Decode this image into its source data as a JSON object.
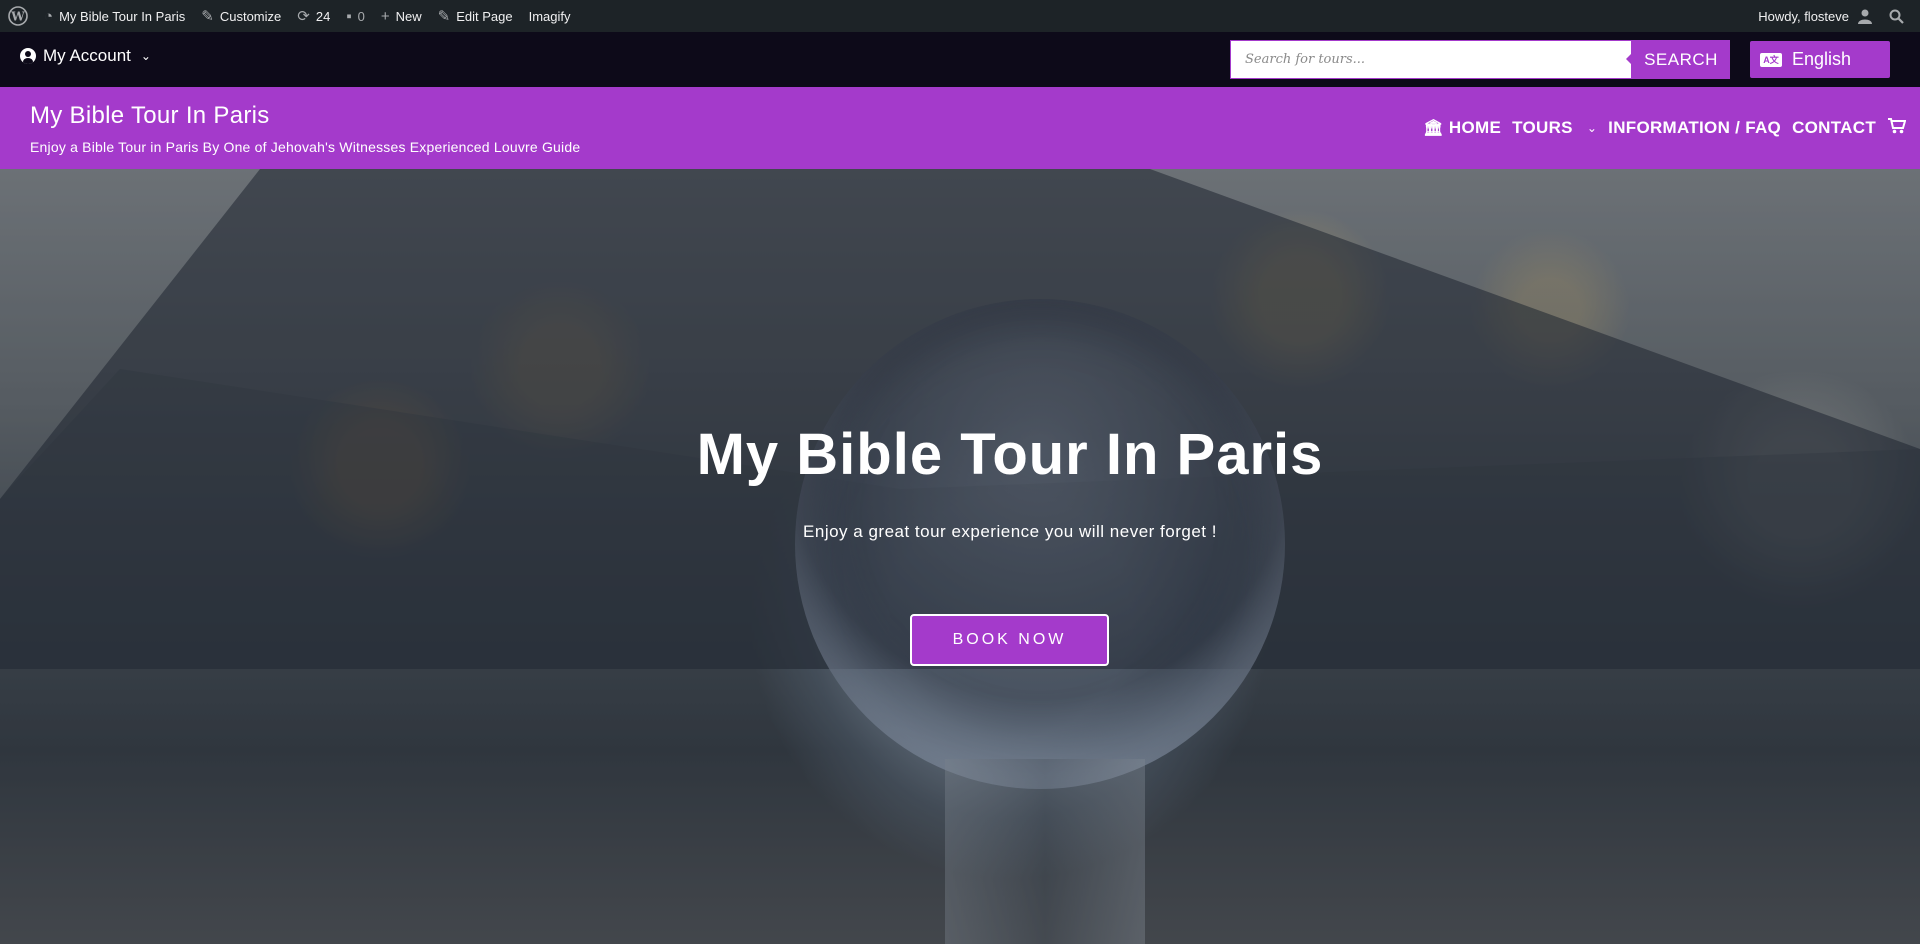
{
  "adminbar": {
    "site_name": "My Bible Tour In Paris",
    "customize": "Customize",
    "updates_count": "24",
    "comments_count": "0",
    "new": "New",
    "edit_page": "Edit Page",
    "imagify": "Imagify",
    "howdy": "Howdy, flosteve"
  },
  "topbar": {
    "account_label": "My Account",
    "search_placeholder": "Search for tours...",
    "search_button": "SEARCH",
    "language": "English"
  },
  "header": {
    "site_title": "My Bible Tour In Paris",
    "tagline": "Enjoy a Bible Tour in Paris By One of Jehovah's Witnesses Experienced Louvre Guide",
    "nav": {
      "home": "HOME",
      "tours": "TOURS",
      "info": "INFORMATION / FAQ",
      "contact": "CONTACT"
    }
  },
  "hero": {
    "title": "My Bible Tour In Paris",
    "subtitle": "Enjoy a great tour experience you will never forget !",
    "button": "BOOK NOW"
  },
  "colors": {
    "accent": "#a43acb",
    "adminbar": "#1d2327",
    "topbar": "#0d0a19"
  }
}
